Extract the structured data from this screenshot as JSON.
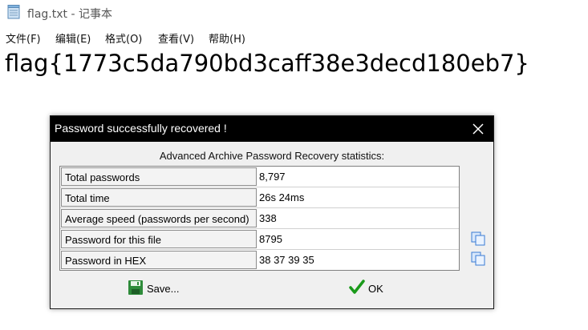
{
  "window": {
    "title": "flag.txt - 记事本"
  },
  "menu": {
    "items": [
      {
        "label": "文件(F)"
      },
      {
        "label": "编辑(E)"
      },
      {
        "label": "格式(O)"
      },
      {
        "label": "查看(V)"
      },
      {
        "label": "帮助(H)"
      }
    ]
  },
  "editor": {
    "content": "flag{1773c5da790bd3caff38e3decd180eb7}"
  },
  "dialog": {
    "title": "Password successfully recovered !",
    "heading": "Advanced Archive Password Recovery statistics:",
    "rows": [
      {
        "label": "Total passwords",
        "value": "8,797"
      },
      {
        "label": "Total time",
        "value": "26s 24ms"
      },
      {
        "label": "Average speed (passwords per second)",
        "value": "338"
      },
      {
        "label": "Password for this file",
        "value": "8795"
      },
      {
        "label": "Password in HEX",
        "value": "38 37 39 35"
      }
    ],
    "save_label": "Save...",
    "ok_label": "OK",
    "icons": {
      "close": "close-icon",
      "copy": "copy-icon",
      "save": "floppy-disk-icon",
      "ok": "checkmark-icon"
    },
    "colors": {
      "titlebar": "#000000",
      "ok_check": "#1a9a1a",
      "save_icon": "#2e8b3a",
      "copy_icon": "#3a7bd5"
    }
  }
}
